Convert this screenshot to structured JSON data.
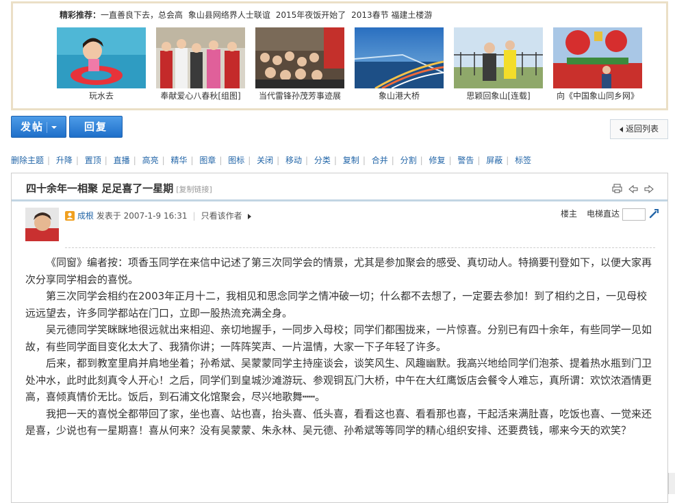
{
  "recommend": {
    "label": "精彩推荐：",
    "links": [
      "一直善良下去，总会高",
      "象山县网络界人士联谊",
      "2015年夜饭开始了",
      "2013春节 福建土楼游"
    ],
    "thumbs": [
      {
        "caption": "玩水去",
        "icon": "photo-child-swim-ring"
      },
      {
        "caption": "奉献爱心八春秋[组图]",
        "icon": "photo-volunteers"
      },
      {
        "caption": "当代雷锋孙茂芳事迹展",
        "icon": "photo-exhibition-crowd"
      },
      {
        "caption": "象山港大桥",
        "icon": "photo-bridge-night"
      },
      {
        "caption": "思颖回象山[连载]",
        "icon": "photo-man-and-girl"
      },
      {
        "caption": "向《中国象山同乡网》",
        "icon": "photo-festival-stage"
      }
    ]
  },
  "actions": {
    "post_label": "发帖",
    "reply_label": "回复",
    "back_label": "返回列表"
  },
  "moderation": [
    "删除主题",
    "升降",
    "置顶",
    "直播",
    "高亮",
    "精华",
    "图章",
    "图标",
    "关闭",
    "移动",
    "分类",
    "复制",
    "合并",
    "分割",
    "修复",
    "警告",
    "屏蔽",
    "标签"
  ],
  "thread": {
    "title": "四十余年一相聚 足足喜了一星期",
    "copy_link": "[复制链接]",
    "author": "成根",
    "posted": "发表于 2007-1-9 16:31",
    "only_author": "只看该作者",
    "floor_label": "楼主",
    "elevator_label": "电梯直达",
    "elevator_value": "",
    "paragraphs": [
      "《同窗》编者按：项香玉同学在来信中记述了第三次同学会的情景，尤其是参加聚会的感受、真切动人。特摘要刊登如下，以便大家再次分享同学相会的喜悦。",
      "第三次同学会相约在2003年正月十二，我相见和思念同学之情冲破一切；什么都不去想了，一定要去参加！到了相约之日，一见母校远远望去，许多同学都站在门口，立即一股热流充满全身。",
      "吴元德同学笑眯眯地很远就出来相迎、亲切地握手，一同步入母校；同学们都围拢来，一片惊喜。分别已有四十余年，有些同学一见如故，有些同学面目变化太大了、我猜你讲；一阵阵笑声、一片温情，大家一下子年轻了许多。",
      "后来，都到教室里肩并肩地坐着；孙希斌、吴蒙蒙同学主持座谈会，谈笑风生、风趣幽默。我高兴地给同学们泡茶、提着热水瓶到门卫处冲水，此时此刻真令人开心！之后，同学们到皇城沙滩游玩、参观铜瓦门大桥，中午在大红鹰饭店会餐令人难忘，真所谓：欢饮浓酒情更高，喜倾真情价无比。饭后，到石浦文化馆聚会，尽兴地歌舞┅┅。",
      "我把一天的喜悦全都带回了家，坐也喜、站也喜，抬头喜、低头喜，看看这也喜、看看那也喜，干起活来满肚喜，吃饭也喜、一觉来还是喜，少说也有一星期喜！喜从何来？没有吴蒙蒙、朱永林、吴元德、孙希斌等等同学的精心组织安排、还要费钱，哪来今天的欢笑？"
    ]
  },
  "colors": {
    "accent_blue": "#1f6fc9",
    "link_blue": "#2366a8",
    "recommend_border": "#ebdfc6",
    "header_rule": "#c2d5e3"
  }
}
